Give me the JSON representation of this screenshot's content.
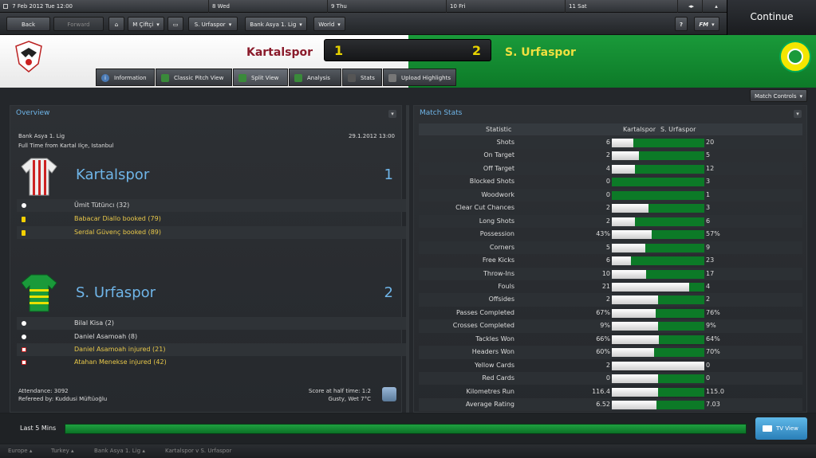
{
  "datebar": {
    "current": "7 Feb 2012",
    "day": "Tue",
    "time": "12:00",
    "days": [
      "8 Wed",
      "9 Thu",
      "10 Fri",
      "11 Sat"
    ]
  },
  "nav": {
    "back": "Back",
    "forward": "Forward",
    "manager": "M Çiftçi",
    "team": "S. Urfaspor",
    "league": "Bank Asya 1. Lig",
    "world": "World",
    "help": "?",
    "fm": "FM",
    "continue": "Continue"
  },
  "match": {
    "home_team": "Kartalspor",
    "away_team": "S. Urfaspor",
    "home_score": "1",
    "away_score": "2"
  },
  "tabs": [
    {
      "label": "Information",
      "icon": "info-icon"
    },
    {
      "label": "Classic Pitch View",
      "icon": "pitch-icon"
    },
    {
      "label": "Split View",
      "icon": "split-view-icon"
    },
    {
      "label": "Analysis",
      "icon": "analysis-icon"
    },
    {
      "label": "Stats",
      "icon": "stats-icon"
    },
    {
      "label": "Upload Highlights",
      "icon": "upload-icon"
    }
  ],
  "match_controls": "Match Controls",
  "overview": {
    "title": "Overview",
    "competition": "Bank Asya 1. Lig",
    "date": "29.1.2012 13:00",
    "venue": "Full Time from Kartal Ilçe, Istanbul",
    "home": {
      "name": "Kartalspor",
      "score": "1",
      "events": [
        {
          "text": "Ümit Tütüncı (32)",
          "type": "goal"
        },
        {
          "text": "Babacar Diallo booked (79)",
          "type": "booking"
        },
        {
          "text": "Serdal Güvenç booked (89)",
          "type": "booking"
        }
      ]
    },
    "away": {
      "name": "S. Urfaspor",
      "score": "2",
      "events": [
        {
          "text": "Bilal Kisa (2)",
          "type": "goal"
        },
        {
          "text": "Daniel Asamoah (8)",
          "type": "goal"
        },
        {
          "text": "Daniel Asamoah injured (21)",
          "type": "injury"
        },
        {
          "text": "Atahan Menekse injured (42)",
          "type": "injury"
        }
      ]
    },
    "attendance": "Attendance: 3092",
    "referee": "Refereed by: Kuddusi Müftüoğlu",
    "halftime": "Score at half time: 1:2",
    "weather": "Gusty, Wet 7°C"
  },
  "stats": {
    "title": "Match Stats",
    "header_stat": "Statistic",
    "header_home": "Kartalspor",
    "header_away": "S. Urfaspor",
    "rows": [
      {
        "name": "Shots",
        "home": "6",
        "away": "20",
        "share": 0.23
      },
      {
        "name": "On Target",
        "home": "2",
        "away": "5",
        "share": 0.29
      },
      {
        "name": "Off Target",
        "home": "4",
        "away": "12",
        "share": 0.25
      },
      {
        "name": "Blocked Shots",
        "home": "0",
        "away": "3",
        "share": 0.0
      },
      {
        "name": "Woodwork",
        "home": "0",
        "away": "1",
        "share": 0.0
      },
      {
        "name": "Clear Cut Chances",
        "home": "2",
        "away": "3",
        "share": 0.4
      },
      {
        "name": "Long Shots",
        "home": "2",
        "away": "6",
        "share": 0.25
      },
      {
        "name": "Possession",
        "home": "43%",
        "away": "57%",
        "share": 0.43
      },
      {
        "name": "Corners",
        "home": "5",
        "away": "9",
        "share": 0.36
      },
      {
        "name": "Free Kicks",
        "home": "6",
        "away": "23",
        "share": 0.21
      },
      {
        "name": "Throw-Ins",
        "home": "10",
        "away": "17",
        "share": 0.37
      },
      {
        "name": "Fouls",
        "home": "21",
        "away": "4",
        "share": 0.84
      },
      {
        "name": "Offsides",
        "home": "2",
        "away": "2",
        "share": 0.5
      },
      {
        "name": "Passes Completed",
        "home": "67%",
        "away": "76%",
        "share": 0.47
      },
      {
        "name": "Crosses Completed",
        "home": "9%",
        "away": "9%",
        "share": 0.5
      },
      {
        "name": "Tackles Won",
        "home": "66%",
        "away": "64%",
        "share": 0.51
      },
      {
        "name": "Headers Won",
        "home": "60%",
        "away": "70%",
        "share": 0.46
      },
      {
        "name": "Yellow Cards",
        "home": "2",
        "away": "0",
        "share": 1.0
      },
      {
        "name": "Red Cards",
        "home": "0",
        "away": "0",
        "share": 0.5
      },
      {
        "name": "Kilometres Run",
        "home": "116.4",
        "away": "115.0",
        "share": 0.5
      },
      {
        "name": "Average Rating",
        "home": "6.52",
        "away": "7.03",
        "share": 0.48
      }
    ]
  },
  "bottom": {
    "label": "Last 5 Mins",
    "tv_view": "TV View"
  },
  "footer": [
    "Europe",
    "Turkey",
    "Bank Asya 1. Lig",
    "Kartalspor v S. Urfaspor"
  ],
  "colors": {
    "home": "#ffffff",
    "away": "#0c7a27",
    "score": "#e8d400",
    "accent": "#6fb5e8"
  }
}
